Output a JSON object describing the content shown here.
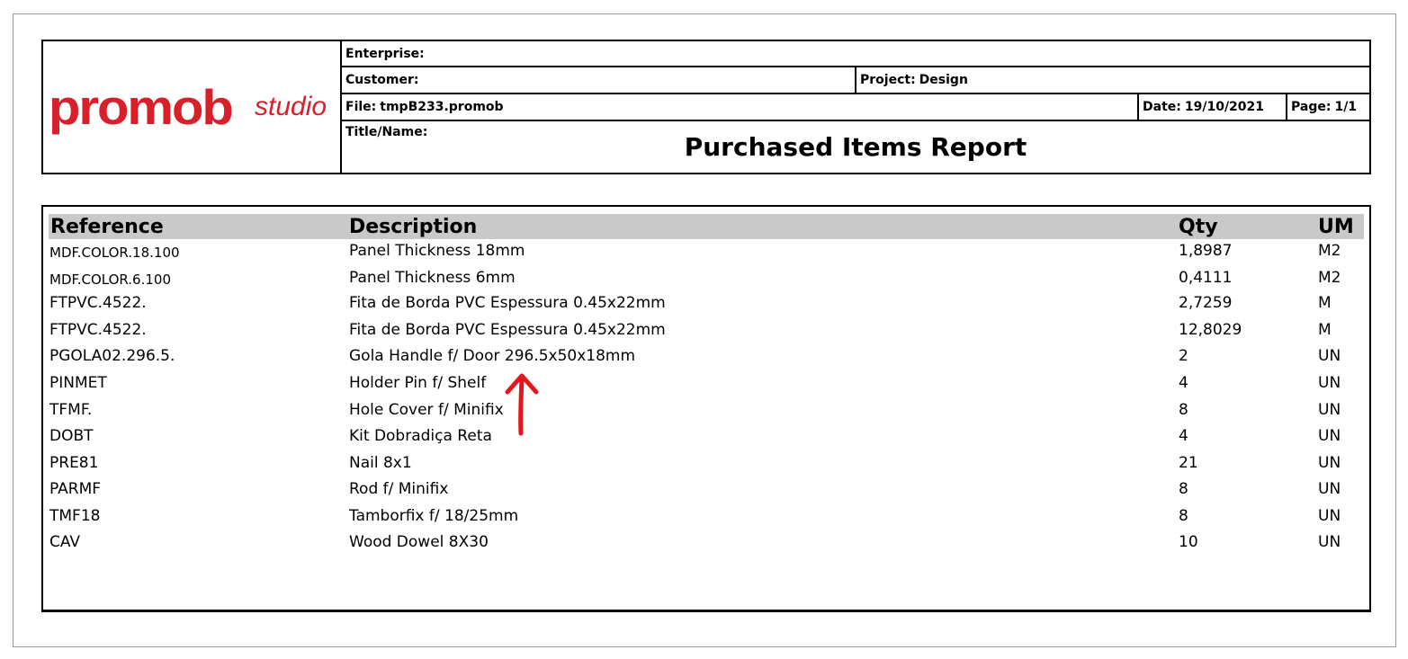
{
  "header": {
    "logo_main": "promob",
    "logo_sub": "studio",
    "enterprise_label": "Enterprise:",
    "enterprise_value": "",
    "customer_label": "Customer:",
    "customer_value": "",
    "project_label": "Project:",
    "project_value": "Design",
    "file_label": "File:",
    "file_value": "tmpB233.promob",
    "date_label": "Date:",
    "date_value": "19/10/2021",
    "page_label": "Page:",
    "page_value": "1/1",
    "title_label": "Title/Name:",
    "report_title": "Purchased Items Report"
  },
  "table": {
    "columns": [
      "Reference",
      "Description",
      "Qty",
      "UM"
    ],
    "rows": [
      {
        "ref": "MDF.COLOR.18.100",
        "desc": "Panel Thickness 18mm",
        "qty": "1,8987",
        "um": "M2"
      },
      {
        "ref": "MDF.COLOR.6.100",
        "desc": "Panel Thickness 6mm",
        "qty": "0,4111",
        "um": "M2"
      },
      {
        "ref": "FTPVC.4522.",
        "desc": "Fita de Borda PVC Espessura 0.45x22mm",
        "qty": "2,7259",
        "um": "M"
      },
      {
        "ref": "FTPVC.4522.",
        "desc": "Fita de Borda PVC Espessura 0.45x22mm",
        "qty": "12,8029",
        "um": "M"
      },
      {
        "ref": "PGOLA02.296.5.",
        "desc": "Gola Handle f/ Door 296.5x50x18mm",
        "qty": "2",
        "um": "UN"
      },
      {
        "ref": "PINMET",
        "desc": "Holder Pin f/ Shelf",
        "qty": "4",
        "um": "UN"
      },
      {
        "ref": "TFMF.",
        "desc": "Hole Cover f/ Minifix",
        "qty": "8",
        "um": "UN"
      },
      {
        "ref": "DOBT",
        "desc": "Kit Dobradiça Reta",
        "qty": "4",
        "um": "UN"
      },
      {
        "ref": "PRE81",
        "desc": "Nail 8x1",
        "qty": "21",
        "um": "UN"
      },
      {
        "ref": "PARMF",
        "desc": "Rod f/ Minifix",
        "qty": "8",
        "um": "UN"
      },
      {
        "ref": "TMF18",
        "desc": "Tamborfix f/ 18/25mm",
        "qty": "8",
        "um": "UN"
      },
      {
        "ref": "CAV",
        "desc": "Wood Dowel 8X30",
        "qty": "10",
        "um": "UN"
      }
    ]
  },
  "colors": {
    "brand_red": "#d8202a",
    "header_gray": "#c9c9c9",
    "annotation_red": "#e8141c"
  },
  "annotation": {
    "icon": "up-arrow-icon"
  }
}
